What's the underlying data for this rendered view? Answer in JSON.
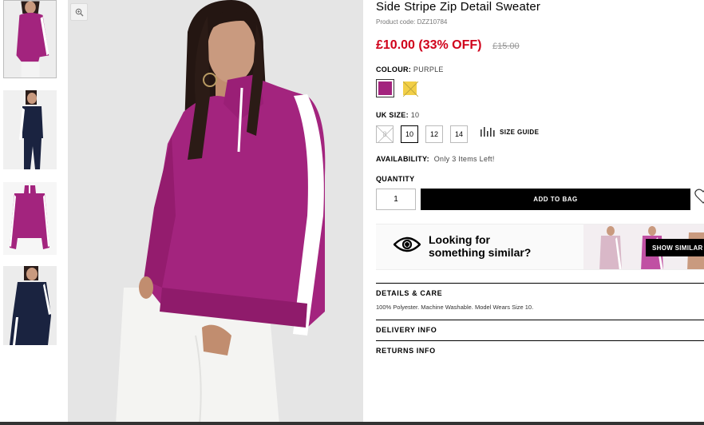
{
  "product": {
    "title": "Side Stripe Zip Detail Sweater",
    "code": "Product code: DZZ10784",
    "price": "£10.00 (33% OFF)",
    "was_price": "£15.00"
  },
  "colour": {
    "label": "COLOUR:",
    "value": "PURPLE",
    "swatches": [
      {
        "name": "purple",
        "color": "#a3247e"
      },
      {
        "name": "yellow",
        "color": "#f2cf47"
      }
    ]
  },
  "size": {
    "label": "UK SIZE:",
    "value": "10",
    "options": [
      "8",
      "10",
      "12",
      "14"
    ],
    "guide": "SIZE GUIDE"
  },
  "availability": {
    "label": "AVAILABILITY:",
    "value": "Only 3 Items Left!"
  },
  "quantity": {
    "label": "QUANTITY",
    "value": "1"
  },
  "add_to_bag": "ADD TO BAG",
  "similar": {
    "line1": "Looking for",
    "line2": "something similar?",
    "button": "SHOW SIMILAR"
  },
  "details": {
    "title": "DETAILS & CARE",
    "body": "100% Polyester. Machine Washable. Model Wears Size 10."
  },
  "delivery": {
    "title": "DELIVERY INFO"
  },
  "returns": {
    "title": "RETURNS INFO"
  },
  "colors": {
    "price_red": "#d0021b",
    "sweater_purple": "#a3247e",
    "stripe_white": "#ffffff"
  }
}
